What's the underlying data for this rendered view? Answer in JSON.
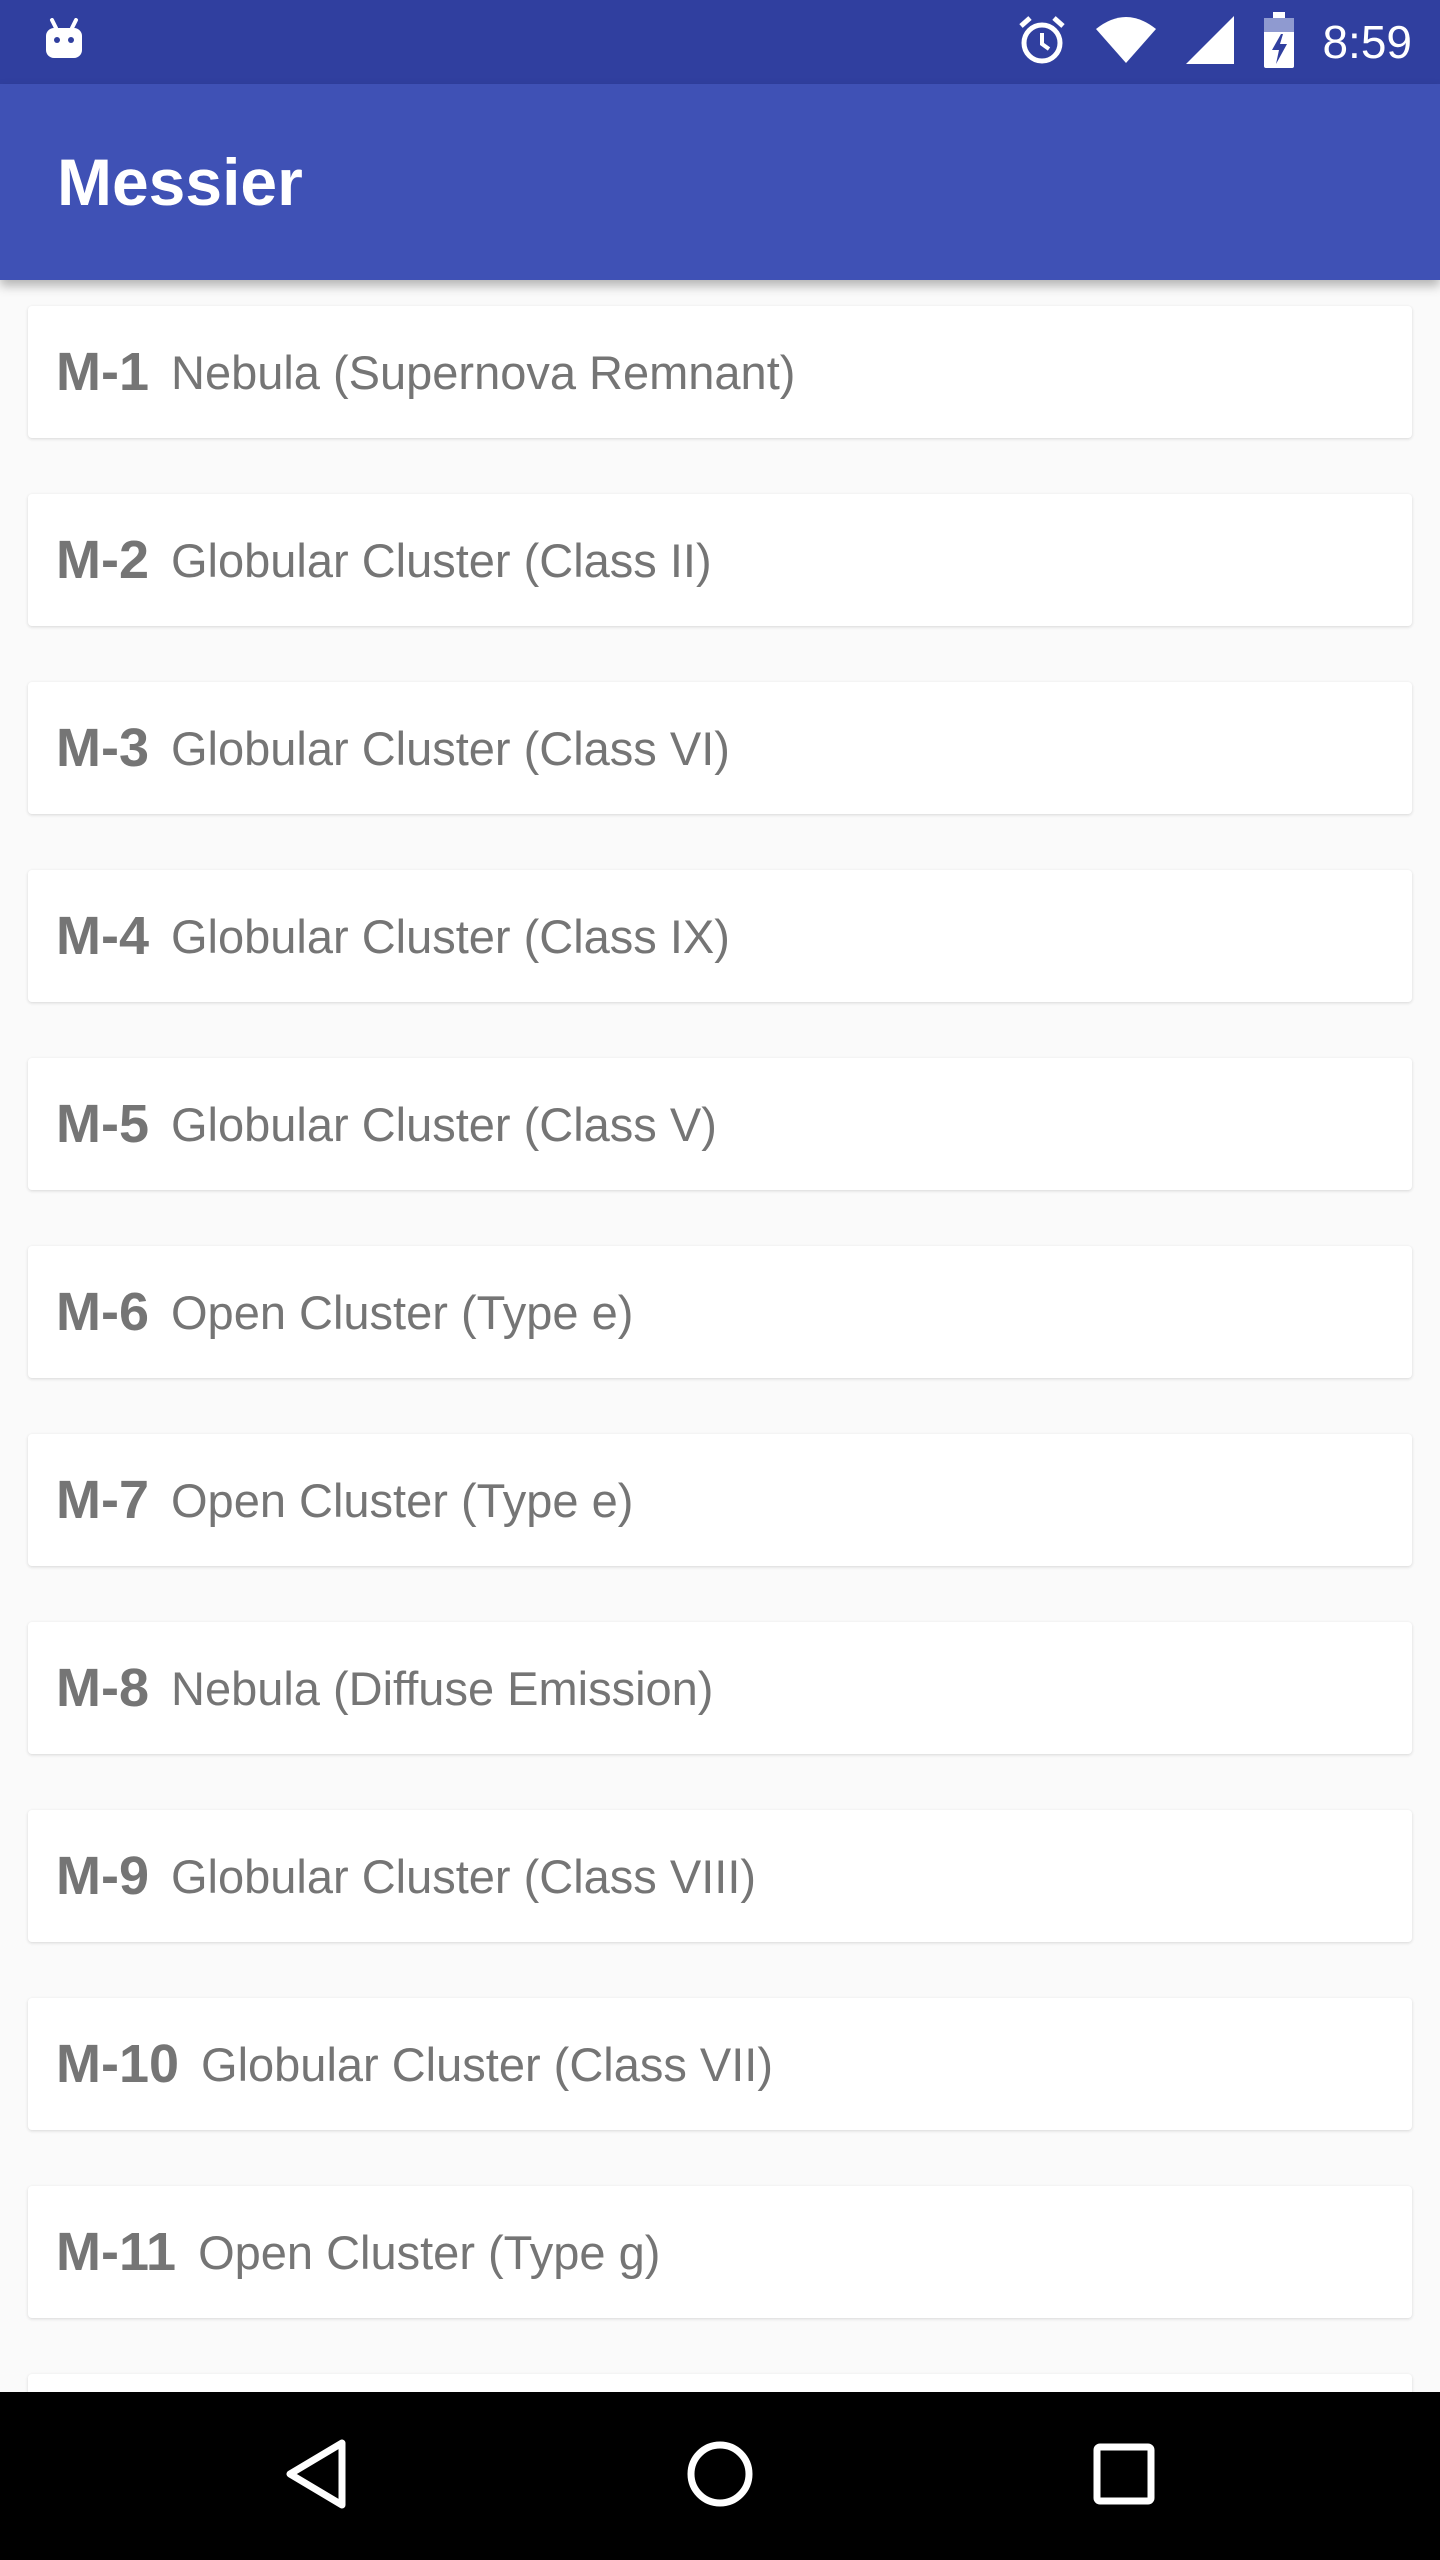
{
  "status_bar": {
    "time": "8:59",
    "icons": [
      "android-icon",
      "alarm-icon",
      "wifi-icon",
      "signal-icon",
      "battery-charging-icon"
    ]
  },
  "app_bar": {
    "title": "Messier"
  },
  "items": [
    {
      "id": "M-1",
      "desc": "Nebula (Supernova Remnant)"
    },
    {
      "id": "M-2",
      "desc": "Globular Cluster (Class II)"
    },
    {
      "id": "M-3",
      "desc": "Globular Cluster (Class VI)"
    },
    {
      "id": "M-4",
      "desc": "Globular Cluster (Class IX)"
    },
    {
      "id": "M-5",
      "desc": "Globular Cluster (Class V)"
    },
    {
      "id": "M-6",
      "desc": "Open Cluster (Type e)"
    },
    {
      "id": "M-7",
      "desc": "Open Cluster (Type e)"
    },
    {
      "id": "M-8",
      "desc": "Nebula (Diffuse Emission)"
    },
    {
      "id": "M-9",
      "desc": "Globular Cluster (Class VIII)"
    },
    {
      "id": "M-10",
      "desc": "Globular Cluster (Class VII)"
    },
    {
      "id": "M-11",
      "desc": "Open Cluster (Type g)"
    },
    {
      "id": "",
      "desc": ""
    }
  ],
  "nav_bar": {
    "buttons": [
      "back-icon",
      "home-icon",
      "recents-icon"
    ]
  },
  "colors": {
    "status_bar": "#303f9f",
    "app_bar": "#3f51b5",
    "background": "#fafafa",
    "card": "#ffffff",
    "text": "#757575"
  }
}
